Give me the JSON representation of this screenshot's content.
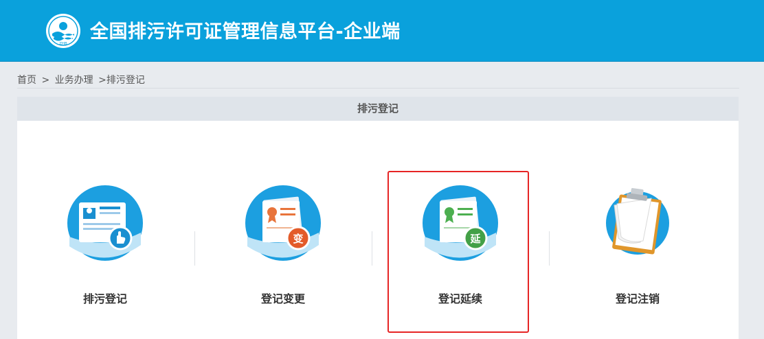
{
  "header": {
    "title": "全国排污许可证管理信息平台-企业端",
    "bg_color": "#0aa1dc",
    "logo_icon": "zhb-emblem-icon"
  },
  "breadcrumb": {
    "home": "首页",
    "sep1": ">",
    "level1": "业务办理",
    "sep2": ">",
    "current": "排污登记"
  },
  "panel": {
    "title": "排污登记"
  },
  "cards": [
    {
      "label": "排污登记",
      "icon": "registration-card-hand-icon"
    },
    {
      "label": "登记变更",
      "icon": "certificate-change-icon",
      "badge": "变"
    },
    {
      "label": "登记延续",
      "icon": "certificate-renewal-icon",
      "badge": "延"
    },
    {
      "label": "登记注销",
      "icon": "clipboard-cancel-icon"
    }
  ],
  "highlight_color": "#e62424"
}
